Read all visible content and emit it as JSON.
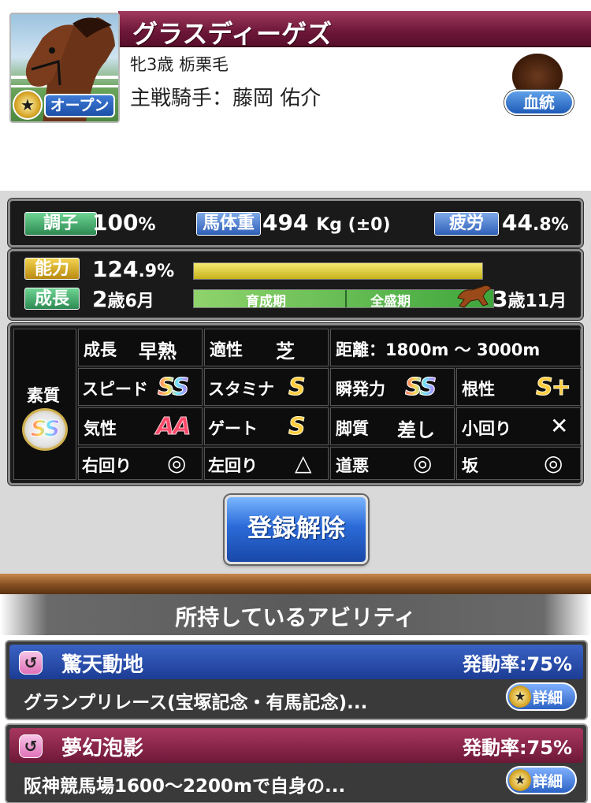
{
  "horse": {
    "name": "グラスディーゲズ",
    "profile": "牝3歳 栃栗毛",
    "jockey": "主戦騎手：藤岡 佑介",
    "rank_label": "オープン",
    "pedigree_label": "血統"
  },
  "condition": {
    "condition_label": "調子",
    "condition_value": "100",
    "condition_unit": "%",
    "weight_label": "馬体重",
    "weight_value": "494",
    "weight_unit": "Kg (±0)",
    "fatigue_label": "疲労",
    "fatigue_value": "44",
    "fatigue_decimal": ".8%"
  },
  "ability": {
    "ability_label": "能力",
    "ability_value": "124",
    "ability_decimal": ".9%",
    "ability_fraction": 1.0,
    "growth_label": "成長",
    "age_now": "2",
    "age_now_suffix": "歳6月",
    "phase_1": "育成期",
    "phase_2": "全盛期",
    "age_end": "3",
    "age_end_suffix": "歳11月",
    "growth_progress": 0.96
  },
  "traits": {
    "quality_label": "素質",
    "quality_grade": "SS",
    "rows": [
      {
        "c1_label": "成長",
        "c1_value": "早熟",
        "c2_label": "適性",
        "c2_value": "芝",
        "c3_label": "距離：1800m 〜 3000m"
      },
      {
        "c1_label": "スピード",
        "c1_value": "SS",
        "c2_label": "スタミナ",
        "c2_value": "S",
        "c3_label": "瞬発力",
        "c3_value": "SS",
        "c4_label": "根性",
        "c4_value": "S+"
      },
      {
        "c1_label": "気性",
        "c1_value": "AA",
        "c2_label": "ゲート",
        "c2_value": "S",
        "c3_label": "脚質",
        "c3_value": "差し",
        "c4_label": "小回り",
        "c4_value": "✕"
      },
      {
        "c1_label": "右回り",
        "c1_value": "◎",
        "c2_label": "左回り",
        "c2_value": "△",
        "c3_label": "道悪",
        "c3_value": "◎",
        "c4_label": "坂",
        "c4_value": "◎"
      }
    ]
  },
  "unregister_label": "登録解除",
  "abilities_header": "所持しているアビリティ",
  "abilities": [
    {
      "name": "驚天動地",
      "rate": "発動率:75%",
      "desc": "グランプリレース(宝塚記念・有馬記念)...",
      "detail": "詳細",
      "color": "blue"
    },
    {
      "name": "夢幻泡影",
      "rate": "発動率:75%",
      "desc": "阪神競馬場1600〜2200mで自身の...",
      "detail": "詳細",
      "color": "red"
    }
  ],
  "colors": {
    "header": "#6c1738",
    "accent_blue": "#2b6bd8",
    "gold": "#e8d23a",
    "growth_green": "#4caf50"
  }
}
